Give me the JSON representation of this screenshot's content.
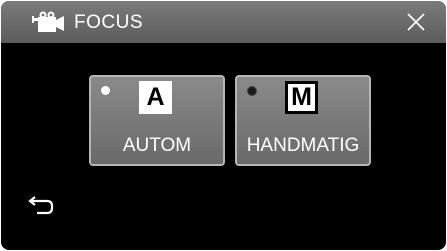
{
  "header": {
    "title": "FOCUS",
    "mode_icon": "video-camera-icon",
    "close_icon": "close-icon"
  },
  "options": [
    {
      "badge": "A",
      "label": "AUTOM",
      "selected": true
    },
    {
      "badge": "M",
      "label": "HANDMATIG",
      "selected": false
    }
  ],
  "footer": {
    "back_icon": "return-arrow-icon"
  },
  "colors": {
    "screen_bg": "#000000",
    "header_bg": "#6b6b6b",
    "button_bg": "#7a7a7a",
    "button_border": "#b5b5b5",
    "text": "#ffffff"
  }
}
